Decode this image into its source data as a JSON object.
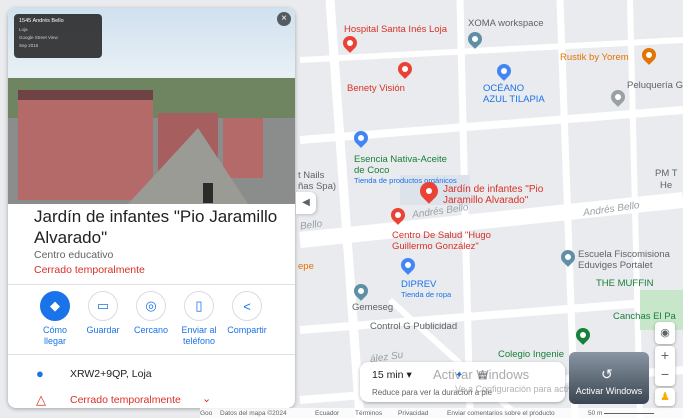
{
  "panel": {
    "photo_caption_1": "1545 Andrés Bello",
    "photo_caption_2": "Loja",
    "photo_caption_3": "Google Street View",
    "photo_caption_4": "Sep 2015",
    "title": "Jardín de infantes \"Pio Jaramillo Alvarado\"",
    "category": "Centro educativo",
    "status": "Cerrado temporalmente",
    "actions": [
      {
        "label": "Cómo llegar",
        "icon": "directions-icon"
      },
      {
        "label": "Guardar",
        "icon": "bookmark-icon"
      },
      {
        "label": "Cercano",
        "icon": "nearby-icon"
      },
      {
        "label": "Enviar al teléfono",
        "icon": "send-to-phone-icon"
      },
      {
        "label": "Compartir",
        "icon": "share-icon"
      }
    ],
    "plus_code": "XRW2+9QP, Loja",
    "hours_status": "Cerrado temporalmente"
  },
  "map": {
    "pois": {
      "hospital": "Hospital Santa Inés Loja",
      "xoma": "XOMA workspace",
      "rustik": "Rustik by Yorem",
      "peluqueria": "Peluquería GUA",
      "benety": "Benety Visión",
      "oceano_1": "OCÉANO",
      "oceano_2": "AZUL TILAPIA",
      "esencia_1": "Esencia Nativa-Aceite",
      "esencia_2": "de Coco",
      "esencia_sub": "Tienda de productos orgánicos",
      "nails_1": "t Nails",
      "nails_2": "ñas Spa)",
      "pm_1": "PM T",
      "pm_2": "He",
      "target_1": "Jardín de infantes \"Pio",
      "target_2": "Jaramillo Alvarado\"",
      "salud_1": "Centro De Salud \"Hugo",
      "salud_2": "Guillermo González\"",
      "diprev": "DIPREV",
      "diprev_sub": "Tienda de ropa",
      "escuela_1": "Escuela Fiscomisiona",
      "escuela_2": "Eduviges Portalet",
      "muffin": "THE MUFFIN",
      "canchas": "Canchas El Pa",
      "gemeseg": "Gemeseg",
      "control": "Control G Publicidad",
      "colegio": "Colegio Ingenie",
      "epe": "epe"
    },
    "roads": {
      "andres_bello_1": "Andrés Bello",
      "andres_bello_2": "Andrés Bello",
      "bello_left": "Bello",
      "lez_su": "ález Su"
    }
  },
  "travel": {
    "time": "15 min",
    "note": "Reduce para ver la duración a pie"
  },
  "watermark": {
    "line1": "Activar Windows",
    "line2": "Ve a Configuración para activar Windows."
  },
  "streetview": {
    "label": "Activar Windows"
  },
  "footer": {
    "google": "Goo",
    "map_data": "Datos del mapa ©2024",
    "country": "Ecuador",
    "terms": "Términos",
    "privacy": "Privacidad",
    "feedback": "Enviar comentarios sobre el producto",
    "scale": "50 m"
  },
  "colors": {
    "accent": "#1a73e8",
    "closed": "#d93025",
    "target_pin": "#ea4335"
  }
}
